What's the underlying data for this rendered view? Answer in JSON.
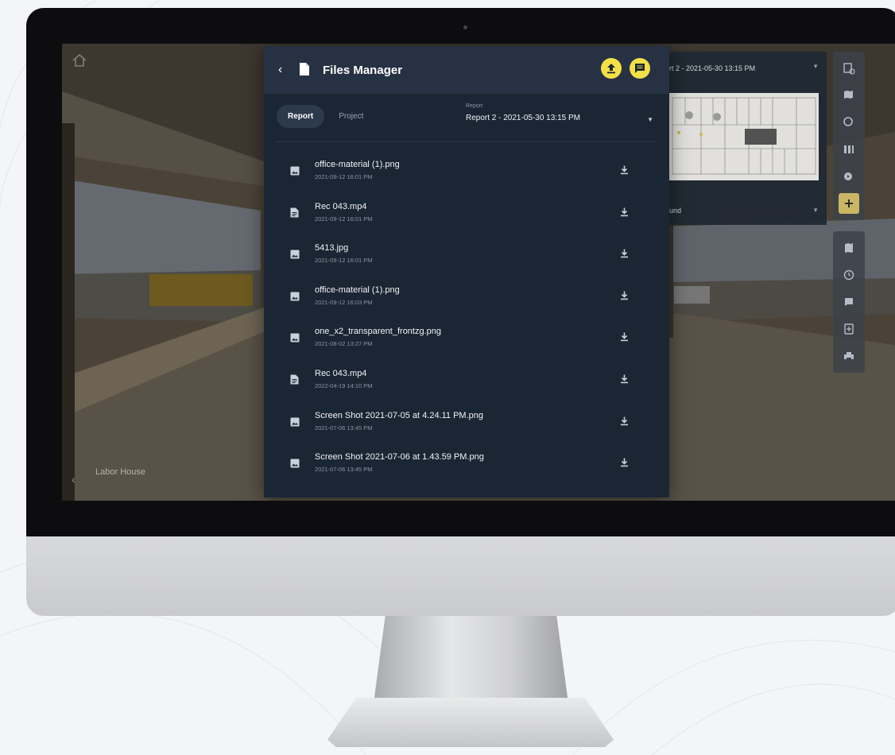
{
  "files_manager": {
    "title": "Files Manager",
    "tabs": [
      {
        "label": "Report",
        "active": true
      },
      {
        "label": "Project",
        "active": false
      }
    ],
    "report_select": {
      "label": "Report",
      "value": "Report 2 - 2021-05-30 13:15 PM"
    },
    "files": [
      {
        "name": "office-material (1).png",
        "date": "2021-09-12 16:01 PM",
        "icon": "image-icon"
      },
      {
        "name": "Rec 043.mp4",
        "date": "2021-09-12 16:01 PM",
        "icon": "document-icon"
      },
      {
        "name": "5413.jpg",
        "date": "2021-09-12 16:01 PM",
        "icon": "image-icon"
      },
      {
        "name": "office-material (1).png",
        "date": "2021-09-12 16:03 PM",
        "icon": "image-icon"
      },
      {
        "name": "one_x2_transparent_frontzg.png",
        "date": "2021-08-02 13:27 PM",
        "icon": "image-icon"
      },
      {
        "name": "Rec 043.mp4",
        "date": "2022-04-19 14:10 PM",
        "icon": "document-icon"
      },
      {
        "name": "Screen Shot 2021-07-05 at 4.24.11 PM.png",
        "date": "2021-07-06 13:45 PM",
        "icon": "image-icon"
      },
      {
        "name": "Screen Shot 2021-07-06 at 1.43.59 PM.png",
        "date": "2021-07-06 13:45 PM",
        "icon": "image-icon"
      }
    ]
  },
  "map_panel": {
    "report_value": "rt 2 - 2021-05-30 13:15 PM",
    "bottom_value": "und"
  },
  "scene": {
    "location_label": "Labor House"
  },
  "colors": {
    "panel_bg": "#1b2634",
    "header_bg": "#263243",
    "accent_yellow": "#f2e046",
    "toolbar_active": "#c9b564"
  }
}
